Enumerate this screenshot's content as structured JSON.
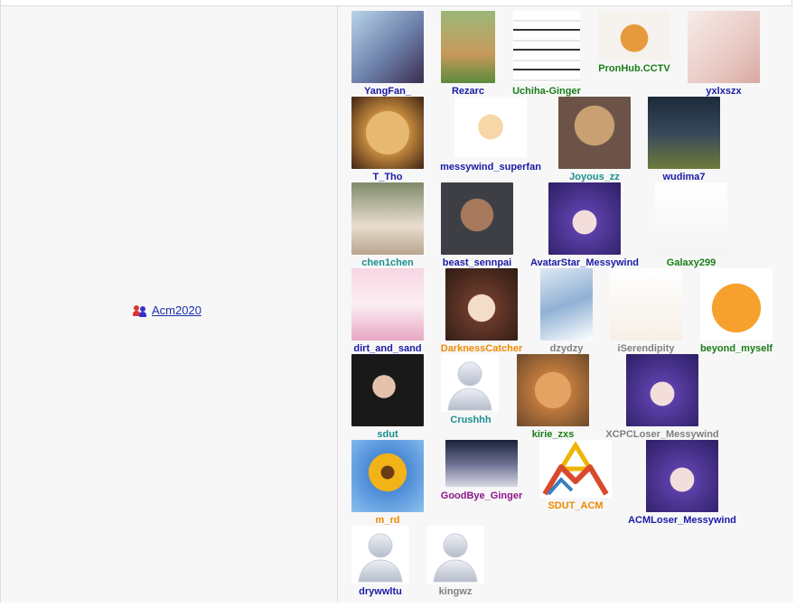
{
  "team": {
    "name": "Acm2020",
    "icon": "team-people-icon"
  },
  "members": [
    {
      "name": "YangFan_",
      "color": "blue",
      "avatar": "anime-boy-avatar"
    },
    {
      "name": "Rezarc",
      "color": "blue",
      "avatar": "lion-dog-avatar"
    },
    {
      "name": "Uchiha-Ginger",
      "color": "green",
      "avatar": "screenshot-collage-avatar"
    },
    {
      "name": "PronHub.CCTV",
      "color": "green",
      "avatar": "orange-cat-avatar"
    },
    {
      "name": "yxlxszx",
      "color": "blue",
      "avatar": "sketch-boy-avatar"
    },
    {
      "name": "T_Tho",
      "color": "blue",
      "avatar": "puppy-avatar"
    },
    {
      "name": "messywind_superfan",
      "color": "blue",
      "avatar": "victini-avatar"
    },
    {
      "name": "Joyous_zz",
      "color": "teal",
      "avatar": "bear-hat-cat-avatar"
    },
    {
      "name": "wudima7",
      "color": "blue",
      "avatar": "anime-swordsman-avatar"
    },
    {
      "name": "chen1chen",
      "color": "teal",
      "avatar": "girl-photo-avatar"
    },
    {
      "name": "beast_sennpai",
      "color": "blue",
      "avatar": "man-photo-avatar"
    },
    {
      "name": "AvatarStar_Messywind",
      "color": "blue",
      "avatar": "purple-hair-anime-avatar"
    },
    {
      "name": "Galaxy299",
      "color": "green",
      "avatar": "calligraphy-avatar"
    },
    {
      "name": "dirt_and_sand",
      "color": "blue",
      "avatar": "white-hair-anime-avatar"
    },
    {
      "name": "DarknessCatcher",
      "color": "orange",
      "avatar": "brown-hair-anime-avatar"
    },
    {
      "name": "dzydzy",
      "color": "gray",
      "avatar": "anime-sketch-avatar"
    },
    {
      "name": "iSerendipity",
      "color": "gray",
      "avatar": "line-art-avatar"
    },
    {
      "name": "beyond_myself",
      "color": "green",
      "avatar": "doge-avatar"
    },
    {
      "name": "sdut",
      "color": "teal",
      "avatar": "woman-photo-avatar"
    },
    {
      "name": "Crushhh",
      "color": "teal",
      "avatar": "default-user-avatar"
    },
    {
      "name": "kirie_zxs",
      "color": "green",
      "avatar": "shiba-avatar"
    },
    {
      "name": "XCPCLoser_Messywind",
      "color": "gray",
      "avatar": "purple-hair-anime-avatar"
    },
    {
      "name": "m_rd",
      "color": "orange",
      "avatar": "sunflower-avatar"
    },
    {
      "name": "GoodBye_Ginger",
      "color": "purple",
      "avatar": "silver-hair-anime-avatar"
    },
    {
      "name": "SDUT_ACM",
      "color": "orange",
      "avatar": "sdut-acm-logo"
    },
    {
      "name": "ACMLoser_Messywind",
      "color": "blue",
      "avatar": "purple-hair-anime-avatar"
    },
    {
      "name": "drywwltu",
      "color": "blue",
      "avatar": "default-user-avatar"
    },
    {
      "name": "kingwz",
      "color": "gray",
      "avatar": "default-user-avatar"
    }
  ],
  "colors": {
    "blue": "#1a1aa6",
    "green": "#1a7d1a",
    "teal": "#1a8f8f",
    "orange": "#f08a00",
    "gray": "#808080",
    "purple": "#8b168b"
  }
}
